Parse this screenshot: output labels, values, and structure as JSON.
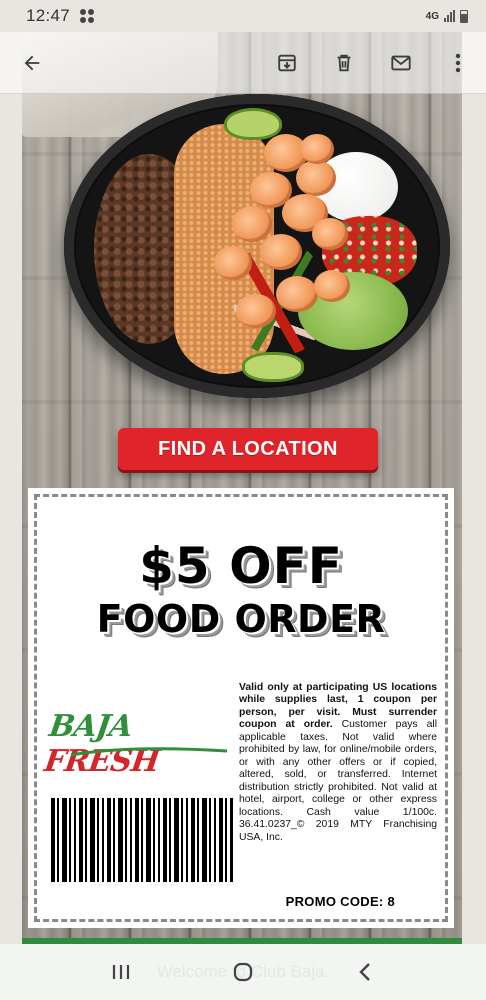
{
  "status_bar": {
    "time": "12:47",
    "network": "4G"
  },
  "toolbar": {
    "icons": [
      "back-arrow-icon",
      "archive-icon",
      "delete-icon",
      "mail-icon",
      "more-vertical-icon"
    ]
  },
  "email": {
    "cta_label": "FIND A LOCATION",
    "coupon": {
      "headline_1": "$5 OFF",
      "headline_2": "FOOD ORDER",
      "logo_word_1": "BAJA",
      "logo_word_2": "FRESH",
      "terms_bold": "Valid only at participating US locations while supplies last, 1 coupon per person, per visit. Must surrender coupon at order.",
      "terms": "Customer pays all applicable taxes. Not valid where prohibited by law, for online/mobile orders, or with any other offers or if copied, altered, sold, or transferred. Internet distribution strictly prohibited. Not valid at hotel, airport, college or other express locations. Cash value 1/100c. 36.41.0237_© 2019 MTY Franchising USA, Inc.",
      "promo_code": "PROMO CODE: 8"
    },
    "footer_text": "Welcome to Club Baja."
  },
  "colors": {
    "cta_red": "#e0252a",
    "brand_green": "#2f8f3a",
    "brand_red": "#d3252a",
    "footer_green": "#2e8c3c"
  },
  "navbar": {
    "icons": [
      "recent-apps-icon",
      "home-icon",
      "back-icon"
    ]
  }
}
